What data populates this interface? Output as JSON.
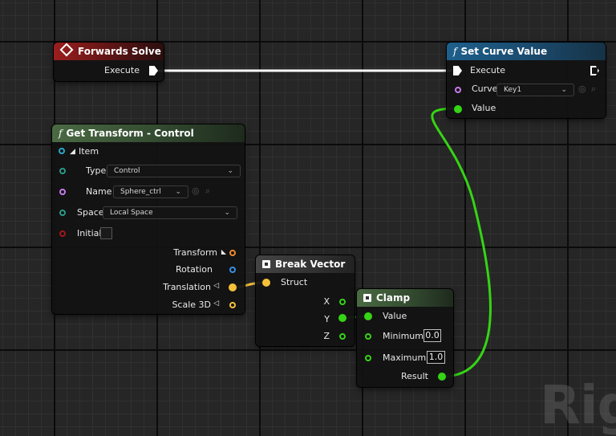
{
  "watermark": "RigV",
  "nodes": {
    "forwards_solve": {
      "title": "Forwards Solve",
      "execute_label": "Execute"
    },
    "set_curve_value": {
      "title": "Set Curve Value",
      "execute_label": "Execute",
      "curve_label": "Curve",
      "curve_value": "Key1",
      "value_label": "Value"
    },
    "get_transform": {
      "title": "Get Transform - Control",
      "item_label": "Item",
      "type_label": "Type",
      "type_value": "Control",
      "name_label": "Name",
      "name_value": "Sphere_ctrl",
      "space_label": "Space",
      "space_value": "Local Space",
      "initial_label": "Initial",
      "transform_label": "Transform",
      "rotation_label": "Rotation",
      "translation_label": "Translation",
      "scale_label": "Scale 3D"
    },
    "break_vector": {
      "title": "Break Vector",
      "struct_label": "Struct",
      "x_label": "X",
      "y_label": "Y",
      "z_label": "Z"
    },
    "clamp": {
      "title": "Clamp",
      "value_label": "Value",
      "minimum_label": "Minimum",
      "minimum_value": "0.0",
      "maximum_label": "Maximum",
      "maximum_value": "1.0",
      "result_label": "Result"
    }
  },
  "colors": {
    "exec": "#ffffff",
    "float": "#35d415",
    "vector": "#f6c13a",
    "transform": "#f08a2a",
    "rotator": "#3a8fe8",
    "name": "#c67bea",
    "struct_teal": "#2a9a8a",
    "bool": "#a01818"
  }
}
